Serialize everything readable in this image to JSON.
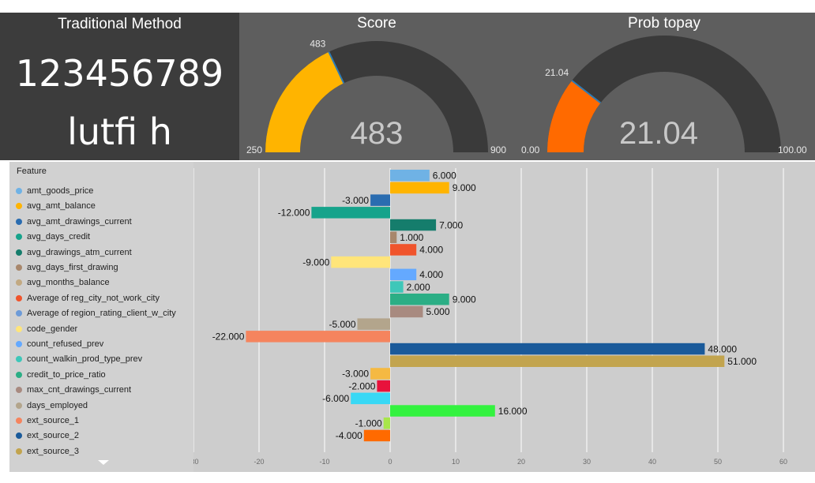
{
  "card": {
    "title": "Traditional Method",
    "id_value": "123456789",
    "name": "lutfi h"
  },
  "gauges": [
    {
      "title": "Score",
      "min": 250,
      "max": 900,
      "value": 483,
      "value_label": "483",
      "marker_label": "483",
      "min_label": "250",
      "max_label": "900",
      "color": "#FFB400"
    },
    {
      "title": "Prob topay",
      "min": 0,
      "max": 100,
      "value": 21.04,
      "value_label": "21.04",
      "marker_label": "21.04",
      "min_label": "0.00",
      "max_label": "100.00",
      "color": "#FF6A00"
    }
  ],
  "legend": {
    "title": "Feature",
    "items": [
      {
        "label": "amt_goods_price",
        "color": "#6FB2E5"
      },
      {
        "label": "avg_amt_balance",
        "color": "#FFB400"
      },
      {
        "label": "avg_amt_drawings_current",
        "color": "#2A6CB0"
      },
      {
        "label": "avg_days_credit",
        "color": "#16A38B"
      },
      {
        "label": "avg_drawings_atm_current",
        "color": "#157D6C"
      },
      {
        "label": "avg_days_first_drawing",
        "color": "#A8876C"
      },
      {
        "label": "avg_months_balance",
        "color": "#C2A982"
      },
      {
        "label": "Average of reg_city_not_work_city",
        "color": "#F0542C"
      },
      {
        "label": "Average of region_rating_client_w_city",
        "color": "#6D9BD8"
      },
      {
        "label": "code_gender",
        "color": "#FFE57A"
      },
      {
        "label": "count_refused_prev",
        "color": "#64A9FF"
      },
      {
        "label": "count_walkin_prod_type_prev",
        "color": "#3EC7B9"
      },
      {
        "label": "credit_to_price_ratio",
        "color": "#2BAE85"
      },
      {
        "label": "max_cnt_drawings_current",
        "color": "#A88A80"
      },
      {
        "label": "days_employed",
        "color": "#B3A58C"
      },
      {
        "label": "ext_source_1",
        "color": "#F5845E"
      },
      {
        "label": "ext_source_2",
        "color": "#1A5A9A"
      },
      {
        "label": "ext_source_3",
        "color": "#C2A44E"
      }
    ]
  },
  "chart_data": {
    "type": "bar",
    "orientation": "horizontal",
    "xlim": [
      -30,
      60
    ],
    "xticks": [
      "-30",
      "-20",
      "-10",
      "0",
      "10",
      "20",
      "30",
      "40",
      "50",
      "60"
    ],
    "grid": true,
    "bars": [
      {
        "value": 6,
        "label": "6.000",
        "color": "#6FB2E5"
      },
      {
        "value": 9,
        "label": "9.000",
        "color": "#FFB400"
      },
      {
        "value": -3,
        "label": "-3.000",
        "color": "#2A6CB0"
      },
      {
        "value": -12,
        "label": "-12.000",
        "color": "#16A38B"
      },
      {
        "value": 7,
        "label": "7.000",
        "color": "#157D6C"
      },
      {
        "value": 1,
        "label": "1.000",
        "color": "#A8876C"
      },
      {
        "value": 4,
        "label": "4.000",
        "color": "#F0542C"
      },
      {
        "value": -9,
        "label": "-9.000",
        "color": "#FFE57A"
      },
      {
        "value": 4,
        "label": "4.000",
        "color": "#64A9FF"
      },
      {
        "value": 2,
        "label": "2.000",
        "color": "#3EC7B9"
      },
      {
        "value": 9,
        "label": "9.000",
        "color": "#2BAE85"
      },
      {
        "value": 5,
        "label": "5.000",
        "color": "#A88A80"
      },
      {
        "value": -5,
        "label": "-5.000",
        "color": "#B3A58C"
      },
      {
        "value": -22,
        "label": "-22.000",
        "color": "#F5845E"
      },
      {
        "value": 48,
        "label": "48.000",
        "color": "#1A5A9A"
      },
      {
        "value": 51,
        "label": "51.000",
        "color": "#C2A44E"
      },
      {
        "value": -3,
        "label": "-3.000",
        "color": "#F5B942"
      },
      {
        "value": -2,
        "label": "-2.000",
        "color": "#E8123C"
      },
      {
        "value": -6,
        "label": "-6.000",
        "color": "#38D8F5"
      },
      {
        "value": 16,
        "label": "16.000",
        "color": "#33F23F"
      },
      {
        "value": -1,
        "label": "-1.000",
        "color": "#A8E64A"
      },
      {
        "value": -4,
        "label": "-4.000",
        "color": "#FF6A00"
      }
    ]
  }
}
